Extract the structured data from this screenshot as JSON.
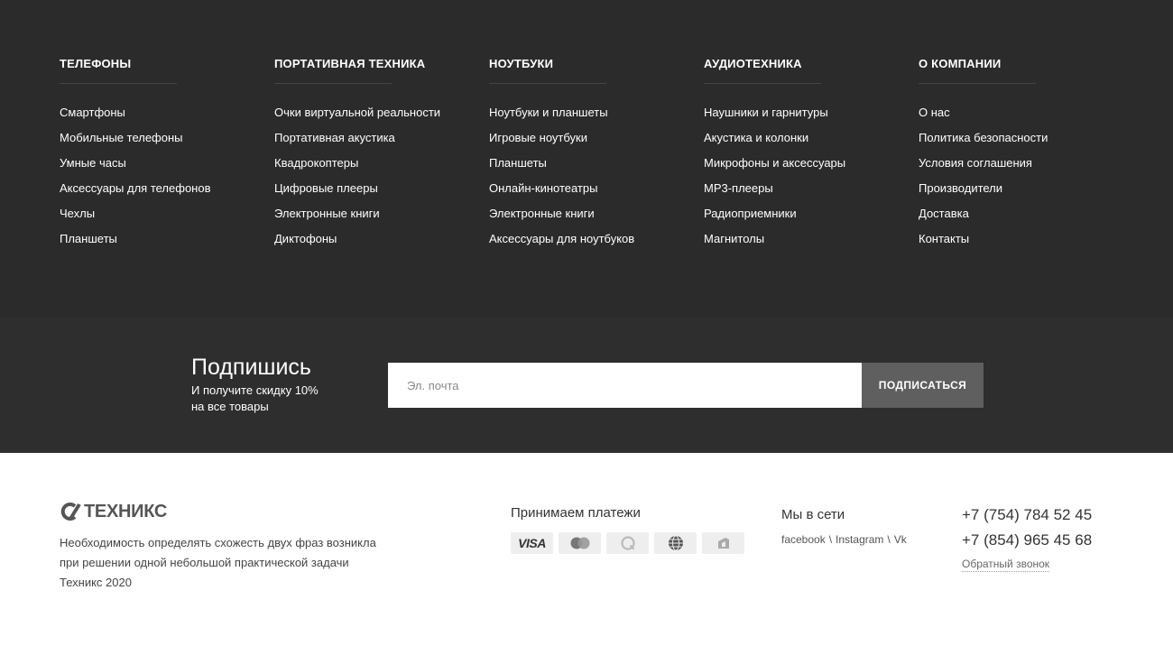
{
  "menu": {
    "columns": [
      {
        "title": "ТЕЛЕФОНЫ",
        "items": [
          "Смартфоны",
          "Мобильные телефоны",
          "Умные часы",
          "Аксессуары для телефонов",
          "Чехлы",
          "Планшеты"
        ]
      },
      {
        "title": "ПОРТАТИВНАЯ ТЕХНИКА",
        "items": [
          "Очки виртуальной реальности",
          "Портативная акустика",
          "Квадрокоптеры",
          "Цифровые плееры",
          "Электронные книги",
          "Диктофоны"
        ]
      },
      {
        "title": "НОУТБУКИ",
        "items": [
          "Ноутбуки и планшеты",
          "Игровые ноутбуки",
          "Планшеты",
          "Онлайн-кинотеатры",
          "Электронные книги",
          "Аксессуары для ноутбуков"
        ]
      },
      {
        "title": "АУДИОТЕХНИКА",
        "items": [
          "Наушники и гарнитуры",
          "Акустика и колонки",
          "Микрофоны и аксессуары",
          "MP3-плееры",
          "Радиоприемники",
          "Магнитолы"
        ]
      },
      {
        "title": "О КОМПАНИИ",
        "items": [
          "О нас",
          "Политика безопасности",
          "Условия соглашения",
          "Производители",
          "Доставка",
          "Контакты"
        ]
      }
    ]
  },
  "subscribe": {
    "title": "Подпишись",
    "text_line1": "И получите скидку 10%",
    "text_line2": "на все товары",
    "placeholder": "Эл. почта",
    "button_label": "ПОДПИСАТЬСЯ"
  },
  "footer": {
    "logo_text": "ТЕХНИКС",
    "about_line1": "Необходимость определять схожесть двух фраз возникла",
    "about_line2": "при решении одной небольшой практической задачи",
    "copyright": "Техникс 2020",
    "payments_title": "Принимаем платежи",
    "payment_visa": "VISA",
    "payment_icons": [
      "visa-icon",
      "mastercard-icon",
      "qiwi-icon",
      "webmoney-icon",
      "yandex-money-icon"
    ],
    "social_title": "Мы в сети",
    "social_links": [
      "facebook",
      "Instagram",
      "Vk"
    ],
    "social_separator": "\\",
    "phone1": "+7 (754) 784 52 45",
    "phone2": "+7 (854) 965 45 68",
    "callback": "Обратный звонок"
  },
  "colors": {
    "menu_bg": "#2b2b2b",
    "subscribe_bg": "#2e2e2e",
    "button_bg": "#5f5f5f",
    "footer_bg": "#ffffff"
  }
}
